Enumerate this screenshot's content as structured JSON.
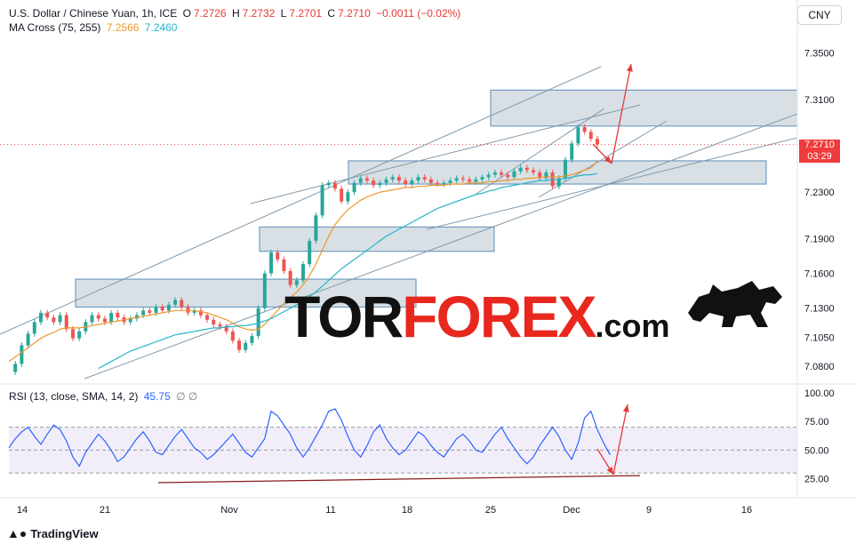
{
  "header": {
    "symbol": "U.S. Dollar / Chinese Yuan, 1h, ICE",
    "o_label": "O",
    "o_value": "7.2726",
    "h_label": "H",
    "h_value": "7.2732",
    "l_label": "L",
    "l_value": "7.2701",
    "c_label": "C",
    "c_value": "7.2710",
    "change": "−0.0011 (−0.02%)",
    "indicator": "MA Cross (75, 255)",
    "ma_fast_value": "7.2566",
    "ma_slow_value": "7.2460"
  },
  "currency_button": "CNY",
  "price_tag": {
    "price": "7.2710",
    "countdown": "03:29"
  },
  "rsi_header": {
    "label": "RSI (13, close, SMA, 14, 2)",
    "value": "45.75",
    "icons": "∅ ∅"
  },
  "branding": {
    "text": "TradingView",
    "icon": "tradingview-logo-icon"
  },
  "watermark": {
    "part1": "TOR",
    "part2": "FOREX",
    "part3": ".com",
    "icon": "bull-icon"
  },
  "colors": {
    "up": "#26a69a",
    "down": "#ef5350",
    "ma_fast": "#f0962d",
    "ma_slow": "#26b5c9",
    "rsi": "#2962ff",
    "zone": "#b8c7d1",
    "arrow": "#e53935",
    "channel": "#7f98ab"
  },
  "chart_data": [
    {
      "type": "line",
      "role": "price",
      "x_labels": [
        "14",
        "21",
        "Nov",
        "11",
        "18",
        "25",
        "Dec",
        "9",
        "16"
      ],
      "y_labels": [
        "7.3500",
        "7.3100",
        "7.2300",
        "7.1900",
        "7.1600",
        "7.1300",
        "7.1050",
        "7.0800"
      ],
      "ylim": [
        7.07,
        7.365
      ],
      "series": [
        {
          "values": [
            7.075,
            7.082,
            7.098,
            7.108,
            7.118,
            7.126,
            7.122,
            7.118,
            7.124,
            7.112,
            7.104,
            7.11,
            7.118,
            7.124,
            7.121,
            7.118,
            7.126,
            7.122,
            7.118,
            7.121,
            7.124,
            7.128,
            7.126,
            7.131,
            7.128,
            7.133,
            7.137,
            7.131,
            7.126,
            7.128,
            7.124,
            7.12,
            7.116,
            7.114,
            7.11,
            7.102,
            7.094,
            7.1,
            7.106,
            7.13,
            7.16,
            7.178,
            7.172,
            7.162,
            7.15,
            7.154,
            7.168,
            7.188,
            7.21,
            7.236,
            7.238,
            7.233,
            7.222,
            7.23,
            7.238,
            7.242,
            7.24,
            7.236,
            7.238,
            7.241,
            7.243,
            7.24,
            7.237,
            7.24,
            7.243,
            7.241,
            7.238,
            7.237,
            7.238,
            7.24,
            7.242,
            7.241,
            7.239,
            7.241,
            7.243,
            7.245,
            7.247,
            7.245,
            7.243,
            7.248,
            7.251,
            7.249,
            7.247,
            7.242,
            7.247,
            7.235,
            7.242,
            7.258,
            7.272,
            7.286,
            7.282,
            7.276,
            7.271
          ]
        },
        {
          "name": "MA 75",
          "values": [
            7.084,
            7.088,
            7.092,
            7.096,
            7.1,
            7.104,
            7.107,
            7.109,
            7.112,
            7.113,
            7.113,
            7.113,
            7.114,
            7.115,
            7.116,
            7.117,
            7.118,
            7.119,
            7.12,
            7.121,
            7.122,
            7.123,
            7.124,
            7.125,
            7.126,
            7.127,
            7.128,
            7.128,
            7.128,
            7.128,
            7.127,
            7.126,
            7.124,
            7.122,
            7.12,
            7.117,
            7.114,
            7.112,
            7.111,
            7.112,
            7.116,
            7.122,
            7.128,
            7.134,
            7.139,
            7.144,
            7.15,
            7.158,
            7.168,
            7.18,
            7.192,
            7.202,
            7.209,
            7.215,
            7.219,
            7.223,
            7.226,
            7.228,
            7.23,
            7.231,
            7.232,
            7.233,
            7.234,
            7.234,
            7.235,
            7.235,
            7.236,
            7.236,
            7.236,
            7.237,
            7.237,
            7.237,
            7.238,
            7.238,
            7.238,
            7.239,
            7.239,
            7.24,
            7.24,
            7.241,
            7.241,
            7.242,
            7.242,
            7.243,
            7.243,
            7.243,
            7.243,
            7.244,
            7.245,
            7.247,
            7.249,
            7.251,
            7.2566
          ]
        },
        {
          "name": "MA 255",
          "values": [
            null,
            null,
            null,
            null,
            null,
            null,
            null,
            null,
            null,
            null,
            null,
            null,
            null,
            null,
            7.078,
            7.081,
            7.084,
            7.087,
            7.09,
            7.093,
            7.095,
            7.097,
            7.099,
            7.101,
            7.103,
            7.105,
            7.107,
            7.108,
            7.109,
            7.11,
            7.111,
            7.112,
            7.113,
            7.113,
            7.114,
            7.114,
            7.115,
            7.115,
            7.116,
            7.117,
            7.119,
            7.121,
            7.124,
            7.127,
            7.13,
            7.133,
            7.136,
            7.14,
            7.144,
            7.149,
            7.154,
            7.159,
            7.164,
            7.168,
            7.172,
            7.176,
            7.18,
            7.184,
            7.188,
            7.192,
            7.195,
            7.198,
            7.201,
            7.204,
            7.207,
            7.21,
            7.213,
            7.216,
            7.218,
            7.22,
            7.222,
            7.224,
            7.226,
            7.228,
            7.229,
            7.231,
            7.232,
            7.234,
            7.235,
            7.236,
            7.237,
            7.238,
            7.239,
            7.24,
            7.24,
            7.241,
            7.241,
            7.242,
            7.243,
            7.244,
            7.245,
            7.245,
            7.246
          ]
        }
      ],
      "zones": [
        {
          "from": 7.287,
          "to": 7.318
        },
        {
          "from": 7.237,
          "to": 7.257
        },
        {
          "from": 7.179,
          "to": 7.2
        },
        {
          "from": 7.131,
          "to": 7.155
        }
      ],
      "last_price": 7.271
    },
    {
      "type": "line",
      "role": "rsi",
      "title": "RSI (13, close, SMA, 14, 2)",
      "y_labels": [
        "100.00",
        "75.00",
        "50.00",
        "25.00"
      ],
      "ylim": [
        20,
        100
      ],
      "bands": {
        "upper": 70,
        "middle": 50,
        "lower": 30
      },
      "series": [
        {
          "values": [
            52,
            60,
            66,
            70,
            62,
            55,
            64,
            72,
            68,
            58,
            44,
            36,
            48,
            56,
            64,
            58,
            50,
            40,
            44,
            52,
            60,
            66,
            58,
            48,
            46,
            54,
            62,
            68,
            60,
            52,
            48,
            42,
            46,
            52,
            58,
            64,
            56,
            48,
            44,
            52,
            60,
            84,
            80,
            72,
            64,
            52,
            44,
            52,
            62,
            72,
            84,
            86,
            76,
            62,
            50,
            44,
            54,
            66,
            72,
            60,
            52,
            46,
            50,
            58,
            66,
            62,
            54,
            48,
            44,
            52,
            60,
            64,
            58,
            50,
            48,
            56,
            64,
            70,
            60,
            52,
            44,
            38,
            44,
            54,
            62,
            70,
            62,
            50,
            42,
            56,
            78,
            84,
            68,
            56,
            45.75
          ]
        }
      ]
    }
  ]
}
